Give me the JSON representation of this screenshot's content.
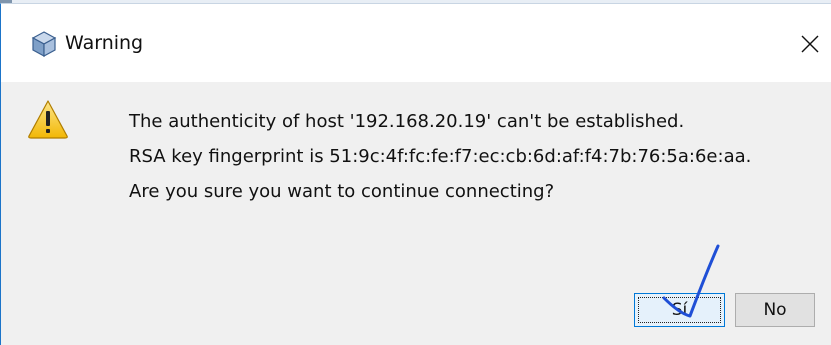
{
  "window": {
    "title": "Warning",
    "app_icon": "java-cube-icon",
    "close_icon": "close-icon"
  },
  "message": {
    "icon": "warning-icon",
    "lines": [
      "The authenticity of host '192.168.20.19' can't be established.",
      "RSA key fingerprint is 51:9c:4f:fc:fe:f7:ec:cb:6d:af:f4:7b:76:5a:6e:aa.",
      "Are you sure you want to continue connecting?"
    ]
  },
  "buttons": {
    "yes_label": "Sí",
    "no_label": "No"
  },
  "annotation": {
    "icon": "checkmark-annotation",
    "color": "#1f4fd6"
  },
  "colors": {
    "window_border": "#1b74c9",
    "dialog_bg": "#f0f0f0",
    "warning_yellow": "#f5c518"
  }
}
